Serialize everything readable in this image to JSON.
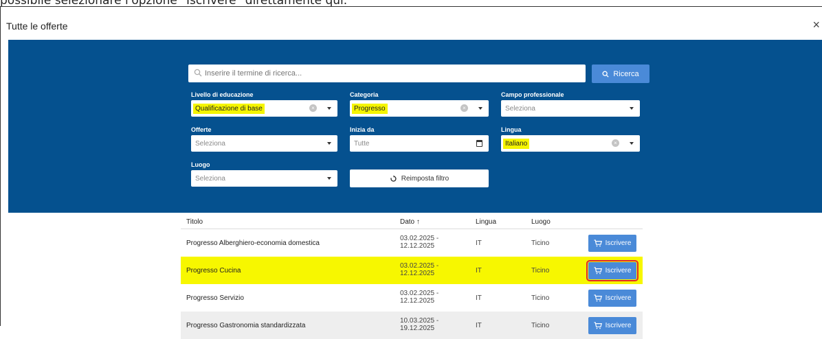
{
  "caption": "possibile selezionare l'opzione \"Iscrivere\" direttamente qui.",
  "dialog": {
    "title": "Tutte le offerte",
    "close_glyph": "×"
  },
  "search": {
    "placeholder": "Inserire il termine di ricerca...",
    "button_label": "Ricerca"
  },
  "filters": {
    "education_level": {
      "label": "Livello di educazione",
      "value": "Qualificazione di base"
    },
    "category": {
      "label": "Categoria",
      "value": "Progresso"
    },
    "professional_field": {
      "label": "Campo professionale",
      "value": "Seleziona"
    },
    "offers": {
      "label": "Offerte",
      "value": "Seleziona"
    },
    "start_from": {
      "label": "Inizia da",
      "value": "Tutte"
    },
    "language": {
      "label": "Lingua",
      "value": "Italiano"
    },
    "location": {
      "label": "Luogo",
      "value": "Seleziona"
    },
    "reset_label": "Reimposta filtro"
  },
  "table": {
    "columns": {
      "title": "Titolo",
      "date": "Dato ↑",
      "language": "Lingua",
      "location": "Luogo"
    },
    "enroll_label": "Iscrivere",
    "rows": [
      {
        "title": "Progresso Alberghiero-economia domestica",
        "date_from": "03.02.2025 -",
        "date_to": "12.12.2025",
        "language": "IT",
        "location": "Ticino"
      },
      {
        "title": "Progresso Cucina",
        "date_from": "03.02.2025 -",
        "date_to": "12.12.2025",
        "language": "IT",
        "location": "Ticino"
      },
      {
        "title": "Progresso Servizio",
        "date_from": "03.02.2025 -",
        "date_to": "12.12.2025",
        "language": "IT",
        "location": "Ticino"
      },
      {
        "title": "Progresso Gastronomia standardizzata",
        "date_from": "10.03.2025 -",
        "date_to": "19.12.2025",
        "language": "IT",
        "location": "Ticino"
      }
    ]
  },
  "colors": {
    "panel": "#05518f",
    "button": "#4a8ad8",
    "highlight": "#f7f700",
    "annotation": "#e0282e"
  }
}
